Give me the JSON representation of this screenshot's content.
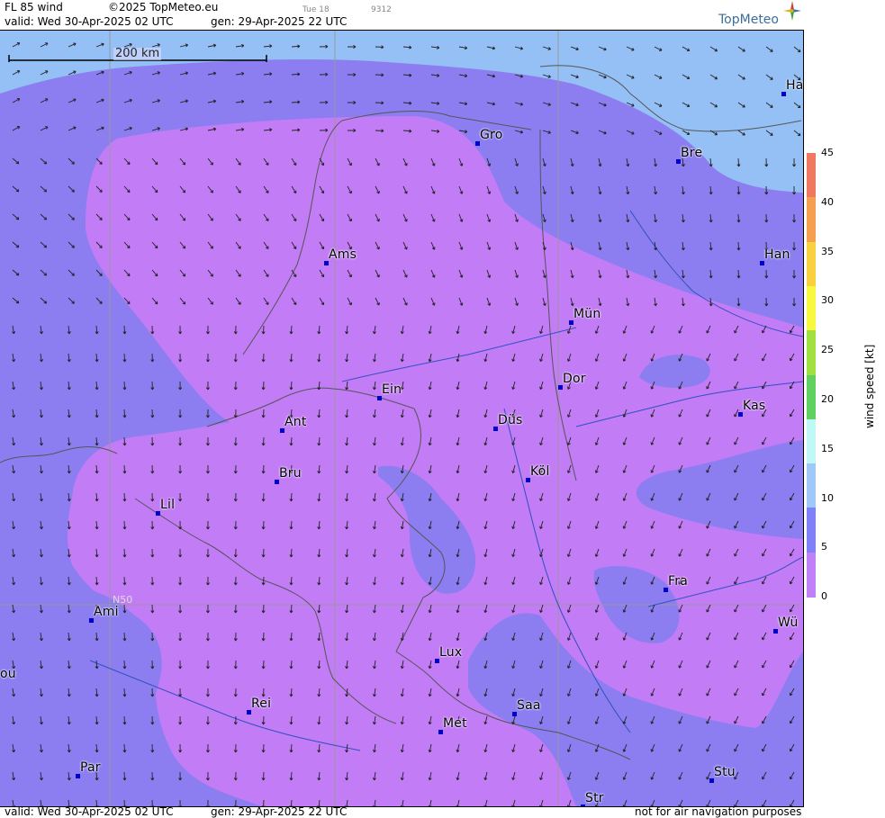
{
  "header": {
    "product": "FL 85 wind",
    "copyright": "©2025 TopMeteo.eu",
    "day_label": "Tue 18",
    "code": "9312",
    "valid": "valid:  Wed  30-Apr-2025  02 UTC",
    "gen": "gen: 29-Apr-2025 22 UTC",
    "logo": "TopMeteo"
  },
  "footer": {
    "valid": "valid:  Wed  30-Apr-2025  02 UTC",
    "gen": "gen: 29-Apr-2025 22 UTC",
    "disclaimer": "not for air navigation purposes"
  },
  "map": {
    "scale_label": "200 km",
    "grid_label": "N50",
    "cities": [
      {
        "name": "Gro"
      },
      {
        "name": "Bre"
      },
      {
        "name": "Ha"
      },
      {
        "name": "Ams"
      },
      {
        "name": "Han"
      },
      {
        "name": "Mün"
      },
      {
        "name": "Dor"
      },
      {
        "name": "Ein"
      },
      {
        "name": "Kas"
      },
      {
        "name": "Ant"
      },
      {
        "name": "Düs"
      },
      {
        "name": "Bru"
      },
      {
        "name": "Köl"
      },
      {
        "name": "Lil"
      },
      {
        "name": "Fra"
      },
      {
        "name": "Ami"
      },
      {
        "name": "Wü"
      },
      {
        "name": "Lux"
      },
      {
        "name": "ou"
      },
      {
        "name": "Rei"
      },
      {
        "name": "Saa"
      },
      {
        "name": "Met"
      },
      {
        "name": "Par"
      },
      {
        "name": "Stu"
      },
      {
        "name": "Str"
      }
    ]
  },
  "colorbar": {
    "label": "wind speed  [kt]",
    "ticks": [
      "45",
      "40",
      "35",
      "30",
      "25",
      "20",
      "15",
      "10",
      "5",
      "0"
    ],
    "colors": [
      "#f07860",
      "#f4a050",
      "#f8d040",
      "#f8f840",
      "#a0e040",
      "#60d060",
      "#c0f8f8",
      "#a0c8f8",
      "#8080f8",
      "#c080f8"
    ]
  },
  "colors": {
    "band_0_5": "#c27cf6",
    "band_5_10": "#8c7ef0",
    "band_10_15": "#94c0f6"
  }
}
